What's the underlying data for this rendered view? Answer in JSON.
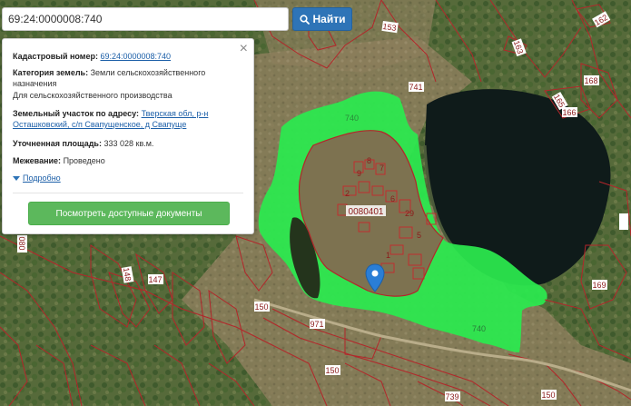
{
  "search": {
    "query": "69:24:0000008:740",
    "button_label": "Найти",
    "icon": "search-icon"
  },
  "panel": {
    "close_icon": "close-icon",
    "cadastral_label": "Кадастровый номер:",
    "cadastral_value": "69:24:0000008:740",
    "category_label": "Категория земель:",
    "category_value_1": "Земли сельскохозяйственного",
    "category_value_2": "назначения",
    "usage": "Для сельскохозяйственного производства",
    "address_label": "Земельный участок по адресу:",
    "address_value_1": "Тверская обл, р-н",
    "address_value_2": "Осташковский, с/п Свапущенское, д Свапуще",
    "area_label": "Уточненная площадь:",
    "area_value": "333 028 кв.м.",
    "survey_label": "Межевание:",
    "survey_value": "Проведено",
    "more_label": "Подробно",
    "docs_button": "Посмотреть доступные документы"
  },
  "map": {
    "colors": {
      "parcel_outline": "#b3262a",
      "highlight_fill": "#2bea4f",
      "label_bg": "#ffffff",
      "label_text": "#8b1a1a",
      "marker": "#2a7ed6",
      "lake": "#0f1b1a"
    },
    "labels": [
      {
        "text": "153"
      },
      {
        "text": "162"
      },
      {
        "text": "163"
      },
      {
        "text": "741"
      },
      {
        "text": "168"
      },
      {
        "text": "165"
      },
      {
        "text": "166"
      },
      {
        "text": "740"
      },
      {
        "text": "9"
      },
      {
        "text": "8"
      },
      {
        "text": "7"
      },
      {
        "text": "6"
      },
      {
        "text": "0080401"
      },
      {
        "text": "29"
      },
      {
        "text": "5"
      },
      {
        "text": "1"
      },
      {
        "text": "147"
      },
      {
        "text": "148"
      },
      {
        "text": "150"
      },
      {
        "text": "971"
      },
      {
        "text": "740"
      },
      {
        "text": "169"
      },
      {
        "text": "150"
      },
      {
        "text": "739"
      },
      {
        "text": "150"
      },
      {
        "text": "080"
      },
      {
        "text": "2"
      }
    ],
    "marker_icon": "map-marker-icon"
  }
}
